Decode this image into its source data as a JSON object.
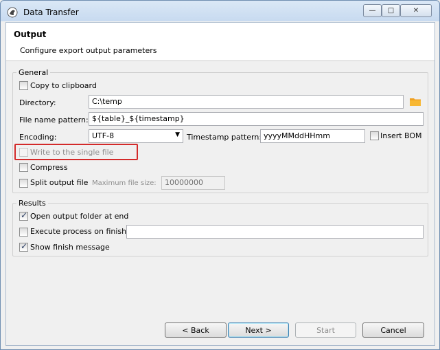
{
  "window": {
    "title": "Data Transfer",
    "controls": {
      "minimize": "—",
      "maximize": "□",
      "close": "✕"
    }
  },
  "header": {
    "title": "Output",
    "subtitle": "Configure export output parameters"
  },
  "general": {
    "legend": "General",
    "copy_to_clipboard": {
      "label": "Copy to clipboard",
      "checked": false
    },
    "directory": {
      "label": "Directory:",
      "value": "C:\\temp"
    },
    "file_name_pattern": {
      "label": "File name pattern:",
      "value": "${table}_${timestamp}"
    },
    "encoding": {
      "label": "Encoding:",
      "value": "UTF-8"
    },
    "timestamp_pattern": {
      "label": "Timestamp pattern:",
      "value": "yyyyMMddHHmm"
    },
    "insert_bom": {
      "label": "Insert BOM",
      "checked": false
    },
    "write_single_file": {
      "label": "Write to the single file",
      "checked": false,
      "enabled": false
    },
    "compress": {
      "label": "Compress",
      "checked": false
    },
    "split_output_file": {
      "label": "Split output file",
      "checked": false
    },
    "max_file_size": {
      "label": "Maximum file size:",
      "value": "10000000"
    }
  },
  "results": {
    "legend": "Results",
    "open_output_folder": {
      "label": "Open output folder at end",
      "checked": true
    },
    "execute_process": {
      "label": "Execute process on finish",
      "checked": false,
      "value": ""
    },
    "show_finish_message": {
      "label": "Show finish message",
      "checked": true
    }
  },
  "buttons": {
    "back": "< Back",
    "next": "Next >",
    "start": "Start",
    "cancel": "Cancel"
  },
  "colors": {
    "highlight_box": "#d32a2a",
    "folder_icon": "#f0a020"
  }
}
